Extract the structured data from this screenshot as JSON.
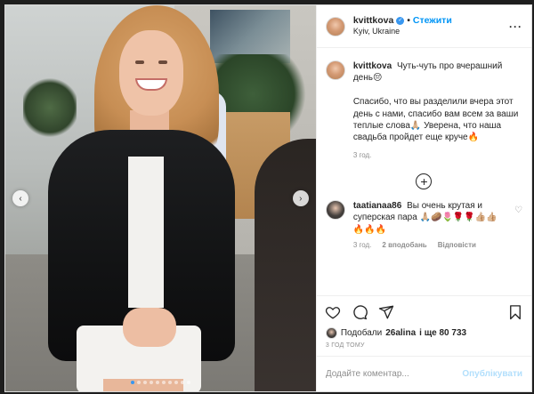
{
  "post": {
    "username": "kvittkova",
    "follow_label": "Стежити",
    "separator": "•",
    "location": "Kyiv, Ukraine",
    "more_label": "···",
    "verified_symbol": "✓"
  },
  "caption": {
    "username": "kvittkova",
    "line1": "Чуть-чуть про вчерашний день😔",
    "line2": "Спасибо, что вы разделили вчера этот день с нами, спасибо вам всем за ваши теплые слова🙏🏼 Уверена, что наша свадьба пройдет еще круче🔥",
    "time": "3 год."
  },
  "load_more": {
    "icon": "plus-circle-icon",
    "symbol": "+"
  },
  "comment": {
    "username": "taatianaa86",
    "text": "Вы очень крутая и суперская пара 🙏🏼🥔🌷🌹🌹👍🏼👍🏼🔥🔥🔥",
    "time": "3 год.",
    "likes": "2 вподобань",
    "reply": "Відповісти",
    "heart_symbol": "♡"
  },
  "actions": {
    "icons": [
      "heart-icon",
      "comment-icon",
      "share-icon",
      "bookmark-icon"
    ]
  },
  "likes": {
    "prefix": "Подобали",
    "user": "26alina",
    "suffix": "і ще 80 733"
  },
  "posted": "3 год тому",
  "add_comment": {
    "placeholder": "Додайте коментар...",
    "publish_label": "Опублікувати"
  },
  "carousel": {
    "prev_symbol": "‹",
    "next_symbol": "›",
    "slides_count": 10,
    "active_index": 0
  },
  "colors": {
    "accent": "#0095f6",
    "publish_disabled": "#b2dffc",
    "text": "#262626",
    "muted": "#8e8e8e"
  }
}
